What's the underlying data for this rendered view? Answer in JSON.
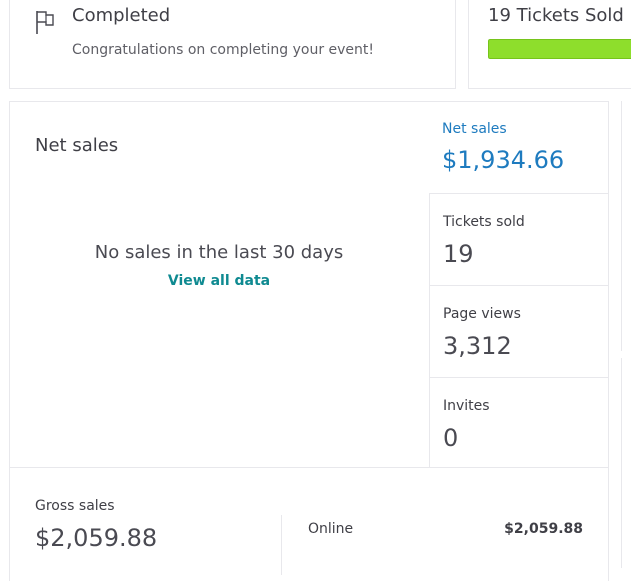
{
  "status_card": {
    "title": "Completed",
    "subtitle": "Congratulations on completing your event!",
    "icon": "flag-icon"
  },
  "tickets_card": {
    "title": "19 Tickets Sold",
    "progress_fraction": 1.0,
    "bar_color": "#8ede2c"
  },
  "net_sales_panel": {
    "title": "Net sales",
    "empty_message": "No sales in the last 30 days",
    "view_all_link": "View all data"
  },
  "stats": {
    "net_sales": {
      "label": "Net sales",
      "value": "$1,934.66"
    },
    "tickets_sold": {
      "label": "Tickets sold",
      "value": "19"
    },
    "page_views": {
      "label": "Page views",
      "value": "3,312"
    },
    "invites": {
      "label": "Invites",
      "value": "0"
    }
  },
  "gross": {
    "label": "Gross sales",
    "value": "$2,059.88",
    "online_label": "Online",
    "online_value": "$2,059.88"
  },
  "colors": {
    "accent_blue": "#1e7bbf",
    "link_teal": "#0f8a91",
    "progress_green": "#8ede2c"
  }
}
